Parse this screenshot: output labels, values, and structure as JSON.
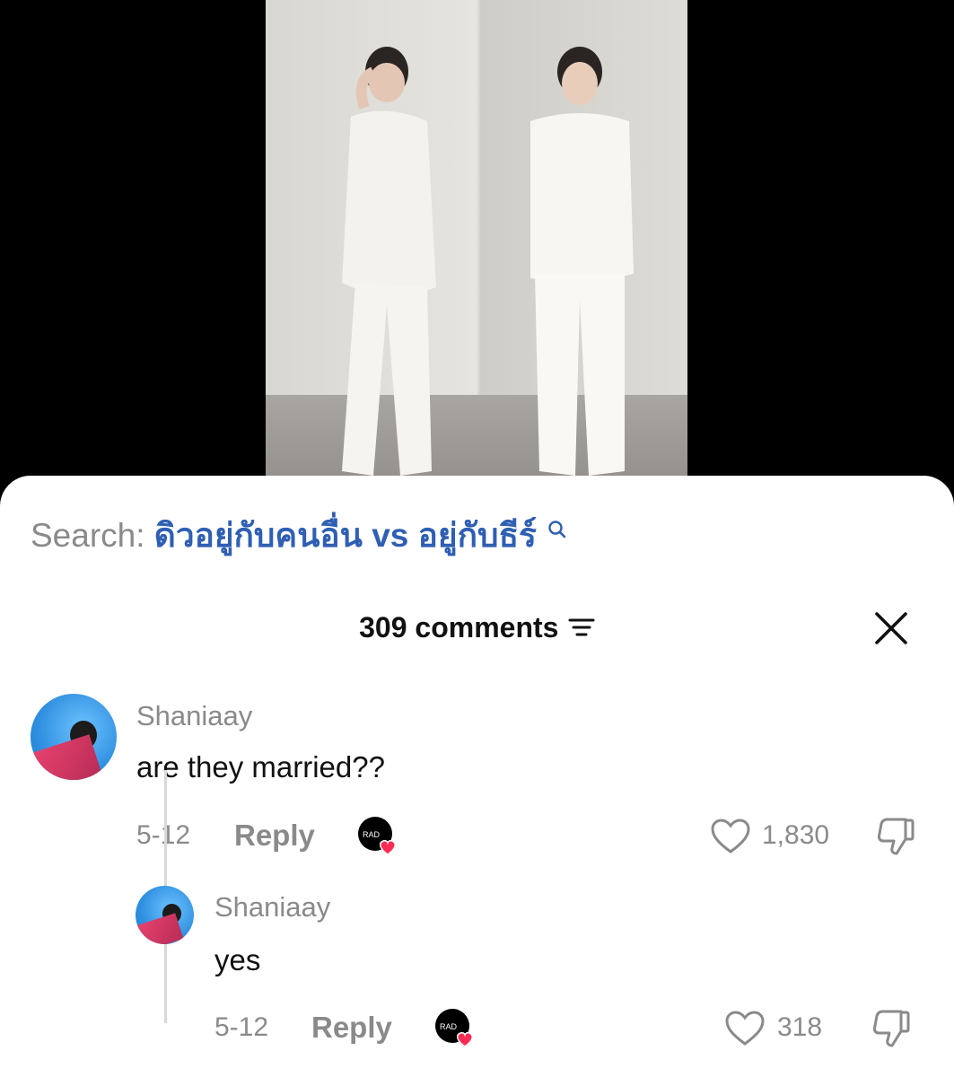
{
  "search": {
    "label": "Search:",
    "term": "ดิวอยู่กับคนอื่น vs อยู่กับธีร์"
  },
  "comments_header": {
    "count_label": "309 comments"
  },
  "comments": [
    {
      "username": "Shaniaay",
      "text": "are they married??",
      "date": "5-12",
      "reply_label": "Reply",
      "likes": "1,830"
    }
  ],
  "replies": [
    {
      "username": "Shaniaay",
      "text": "yes",
      "date": "5-12",
      "reply_label": "Reply",
      "likes": "318"
    }
  ],
  "creator_badge": {
    "text": "RAD"
  },
  "colors": {
    "search_term": "#2f5fb3",
    "muted": "#8a8a8a",
    "heart_badge": "#fe2c55"
  },
  "icons": [
    "search-icon",
    "sort-icon",
    "close-icon",
    "heart-outline-icon",
    "dislike-icon"
  ]
}
